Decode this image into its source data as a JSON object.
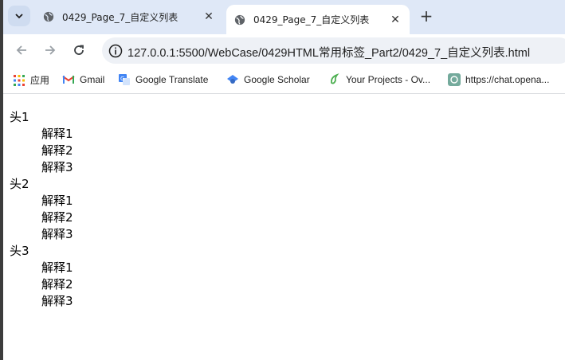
{
  "tabs": [
    {
      "title": "0429_Page_7_自定义列表",
      "active": false
    },
    {
      "title": "0429_Page_7_自定义列表",
      "active": true
    }
  ],
  "toolbar": {
    "url": "127.0.0.1:5500/WebCase/0429HTML常用标签_Part2/0429_7_自定义列表.html"
  },
  "bookmarks": [
    {
      "label": "应用",
      "icon": "apps-grid-icon"
    },
    {
      "label": "Gmail",
      "icon": "gmail-icon"
    },
    {
      "label": "Google Translate",
      "icon": "translate-icon"
    },
    {
      "label": "Google Scholar",
      "icon": "scholar-icon"
    },
    {
      "label": "Your Projects - Ov...",
      "icon": "overleaf-icon"
    },
    {
      "label": "https://chat.opena...",
      "icon": "openai-icon"
    }
  ],
  "page": {
    "groups": [
      {
        "term": "头1",
        "defs": [
          "解释1",
          "解释2",
          "解释3"
        ]
      },
      {
        "term": "头2",
        "defs": [
          "解释1",
          "解释2",
          "解释3"
        ]
      },
      {
        "term": "头3",
        "defs": [
          "解释1",
          "解释2",
          "解释3"
        ]
      }
    ]
  }
}
